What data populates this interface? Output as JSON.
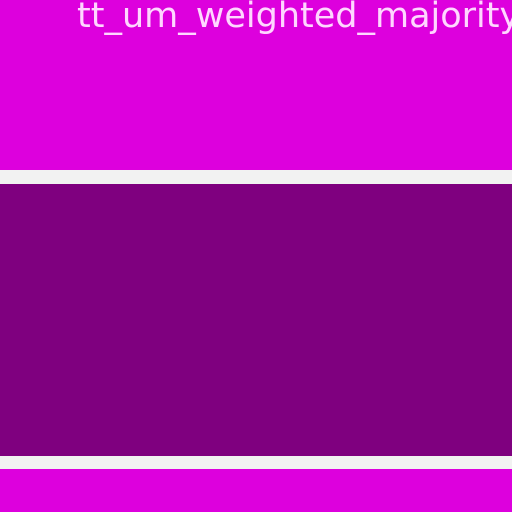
{
  "header": {
    "title": "tt_um_weighted_majority"
  },
  "colors": {
    "background": "#f2f2f2",
    "top_panel": "#dd00dd",
    "middle_panel": "#7f007f",
    "bottom_panel": "#dd00dd",
    "title_text": "#ffd6ff"
  }
}
